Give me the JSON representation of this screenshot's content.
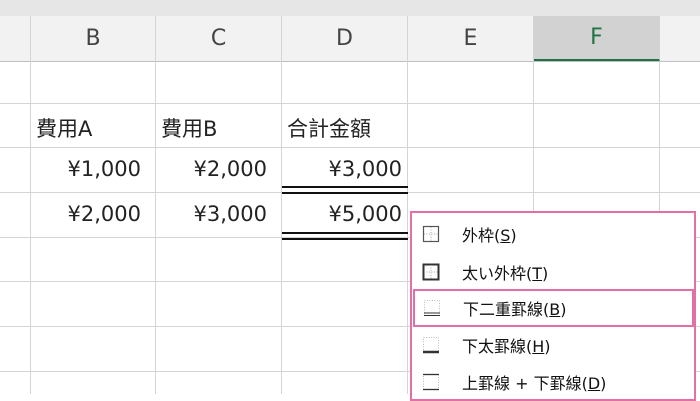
{
  "columns": [
    "B",
    "C",
    "D",
    "E",
    "F"
  ],
  "selected_column": "F",
  "cells": {
    "header": [
      "費用A",
      "費用B",
      "合計金額"
    ],
    "row1": [
      "¥1,000",
      "¥2,000",
      "¥3,000"
    ],
    "row2": [
      "¥2,000",
      "¥3,000",
      "¥5,000"
    ]
  },
  "border_menu": {
    "items": [
      {
        "icon": "outside-borders-icon",
        "text": "外枠(",
        "key": "S",
        "close": ")"
      },
      {
        "icon": "thick-outside-borders-icon",
        "text": "太い外枠(",
        "key": "T",
        "close": ")"
      },
      {
        "icon": "bottom-double-border-icon",
        "text": "下二重罫線(",
        "key": "B",
        "close": ")"
      },
      {
        "icon": "thick-bottom-border-icon",
        "text": "下太罫線(",
        "key": "H",
        "close": ")"
      },
      {
        "icon": "top-and-bottom-border-icon",
        "text": "上罫線 + 下罫線(",
        "key": "D",
        "close": ")"
      }
    ],
    "highlighted_index": 2
  },
  "colors": {
    "accent_green": "#217346",
    "highlight_pink": "#e46fa4"
  }
}
